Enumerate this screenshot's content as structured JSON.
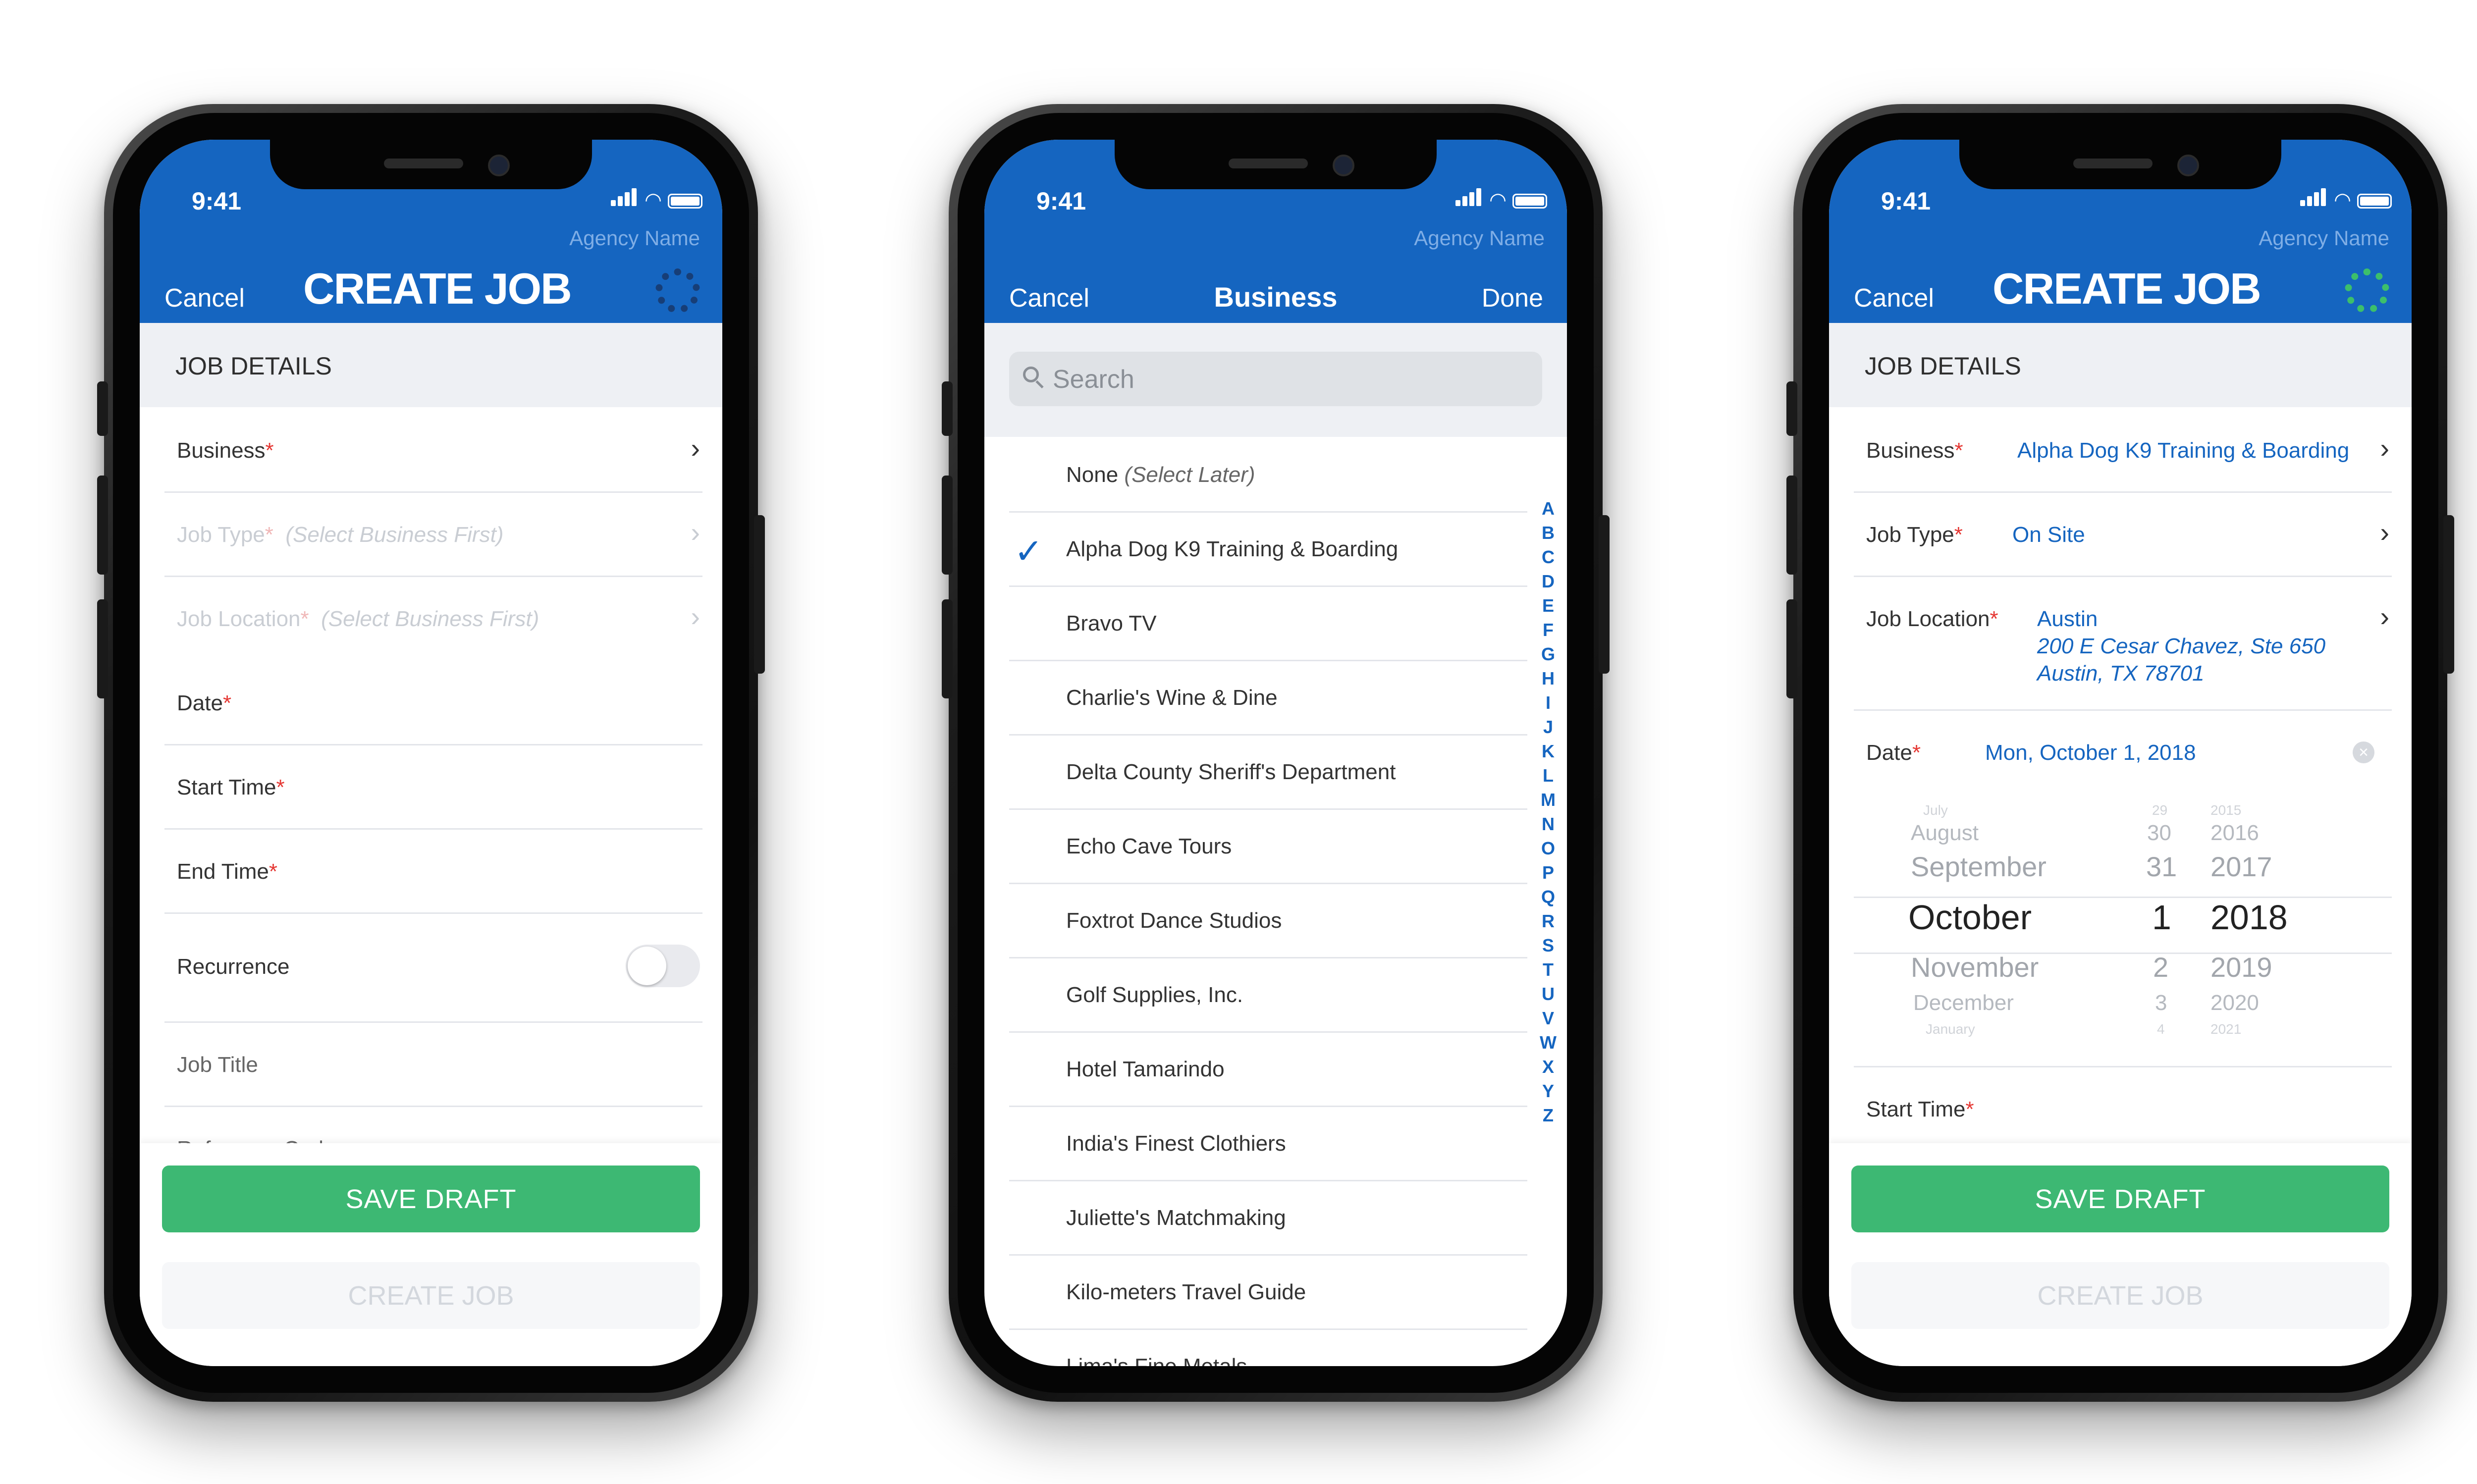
{
  "status": {
    "time": "9:41",
    "agency": "Agency Name"
  },
  "screen1": {
    "cancel": "Cancel",
    "title": "CREATE JOB",
    "section": "JOB DETAILS",
    "rows": {
      "business": "Business",
      "job_type": "Job Type",
      "job_type_hint": "(Select Business First)",
      "job_location": "Job Location",
      "job_location_hint": "(Select Business First)",
      "date": "Date",
      "start_time": "Start Time",
      "end_time": "End Time",
      "recurrence": "Recurrence",
      "job_title": "Job Title",
      "reference_code": "Reference Code"
    },
    "required_mark": "*",
    "save_draft": "SAVE DRAFT",
    "create_job": "CREATE JOB"
  },
  "screen2": {
    "cancel": "Cancel",
    "title": "Business",
    "done": "Done",
    "search_placeholder": "Search",
    "none_label": "None",
    "none_hint": "(Select Later)",
    "items": [
      "Alpha Dog K9 Training & Boarding",
      "Bravo TV",
      "Charlie's Wine & Dine",
      "Delta County Sheriff's Department",
      "Echo Cave Tours",
      "Foxtrot Dance Studios",
      "Golf Supplies, Inc.",
      "Hotel Tamarindo",
      "India's Finest Clothiers",
      "Juliette's Matchmaking",
      "Kilo-meters Travel Guide",
      "Lima's Fine Metals"
    ],
    "selected_index": 0,
    "index_letters": [
      "A",
      "B",
      "C",
      "D",
      "E",
      "F",
      "G",
      "H",
      "I",
      "J",
      "K",
      "L",
      "M",
      "N",
      "O",
      "P",
      "Q",
      "R",
      "S",
      "T",
      "U",
      "V",
      "W",
      "X",
      "Y",
      "Z"
    ]
  },
  "screen3": {
    "cancel": "Cancel",
    "title": "CREATE JOB",
    "section": "JOB DETAILS",
    "business_label": "Business",
    "business_value": "Alpha Dog K9 Training & Boarding",
    "job_type_label": "Job Type",
    "job_type_value": "On Site",
    "job_location_label": "Job Location",
    "location_name": "Austin",
    "location_line1": "200 E Cesar Chavez, Ste 650",
    "location_line2": "Austin, TX 78701",
    "date_label": "Date",
    "date_value": "Mon, October 1, 2018",
    "picker": {
      "months": [
        "July",
        "August",
        "September",
        "October",
        "November",
        "December",
        "January"
      ],
      "days": [
        "29",
        "30",
        "31",
        "1",
        "2",
        "3",
        "4"
      ],
      "years": [
        "2015",
        "2016",
        "2017",
        "2018",
        "2019",
        "2020",
        "2021"
      ]
    },
    "start_time_label": "Start Time",
    "save_draft": "SAVE DRAFT",
    "create_job": "CREATE JOB"
  },
  "colors": {
    "brand_blue": "#1565c0",
    "save_green": "#3db873",
    "required_red": "#e53935"
  }
}
